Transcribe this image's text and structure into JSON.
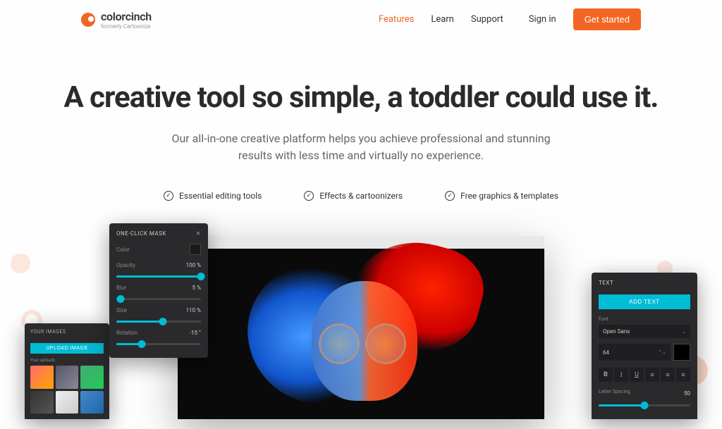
{
  "brand": {
    "name": "colorcinch",
    "subtitle": "formerly Cartoonize"
  },
  "nav": {
    "features": "Features",
    "learn": "Learn",
    "support": "Support",
    "signin": "Sign in",
    "cta": "Get started"
  },
  "hero": {
    "title": "A creative tool so simple, a toddler could use it.",
    "subtitle": "Our all-in-one creative platform helps you achieve professional and stunning results with less time and virtually no experience."
  },
  "features": [
    "Essential editing tools",
    "Effects & cartoonizers",
    "Free graphics & templates"
  ],
  "mask_panel": {
    "title": "ONE-CLICK MASK",
    "rows": {
      "color": "Color",
      "opacity": {
        "label": "Opacity",
        "value": "100 %",
        "pct": 100
      },
      "blur": {
        "label": "Blur",
        "value": "5 %",
        "pct": 5
      },
      "size": {
        "label": "Size",
        "value": "110 %",
        "pct": 55
      },
      "rotation": {
        "label": "Rotation",
        "value": "-15 °",
        "pct": 30
      }
    }
  },
  "images_panel": {
    "title": "YOUR IMAGES",
    "upload": "UPLOAD IMAGE",
    "sub": "Your uploads"
  },
  "text_panel": {
    "title": "TEXT",
    "add": "ADD TEXT",
    "font_label": "Font",
    "font": "Open Sans",
    "size": "64",
    "spacing": {
      "label": "Letter Spacing",
      "value": "50"
    }
  }
}
